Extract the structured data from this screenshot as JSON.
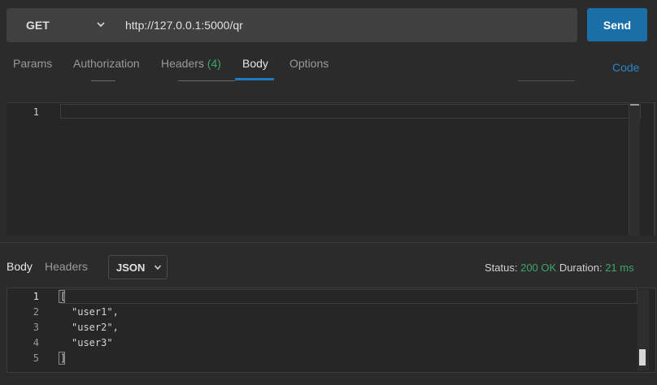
{
  "request": {
    "method": "GET",
    "url": "http://127.0.0.1:5000/qr",
    "send_label": "Send"
  },
  "request_tabs": [
    {
      "label": "Params"
    },
    {
      "label": "Authorization"
    },
    {
      "label": "Headers",
      "count": "(4)"
    },
    {
      "label": "Body",
      "active": true
    },
    {
      "label": "Options"
    }
  ],
  "code_link": "Code",
  "request_body": {
    "line_numbers": [
      "1"
    ]
  },
  "response": {
    "tabs": [
      {
        "label": "Body",
        "active": true
      },
      {
        "label": "Headers"
      }
    ],
    "format": "JSON",
    "status_label": "Status:",
    "status_value": "200 OK",
    "duration_label": "Duration:",
    "duration_value": "21 ms",
    "line_numbers": [
      "1",
      "2",
      "3",
      "4",
      "5"
    ],
    "code_lines": [
      "[",
      "\"user1\",",
      "\"user2\",",
      "\"user3\"",
      "]"
    ]
  },
  "colors": {
    "accent": "#1a6fa8",
    "ok": "#3fa66a",
    "string": "#d49a6a",
    "link": "#2a84c9"
  }
}
